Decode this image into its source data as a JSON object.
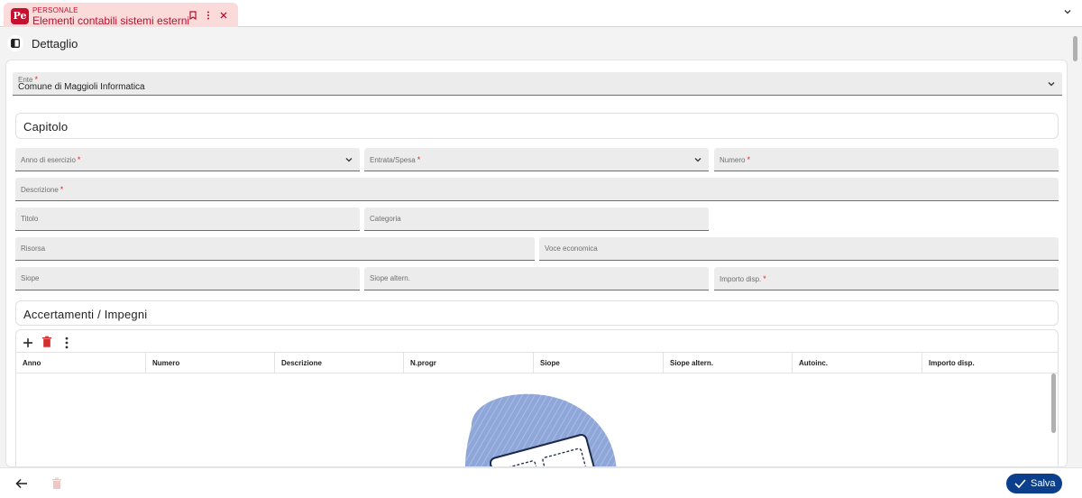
{
  "app": {
    "section": "PERSONALE",
    "title": "Elementi contabili sistemi esterni",
    "logo_text": "Pe"
  },
  "header": {
    "title": "Dettaglio"
  },
  "ente": {
    "label": "Ente",
    "value": "Comune di Maggioli Informatica"
  },
  "capitolo": {
    "title": "Capitolo",
    "fields": {
      "anno": "Anno di esercizio",
      "entrata_spesa": "Entrata/Spesa",
      "numero": "Numero",
      "descrizione": "Descrizione",
      "titolo": "Titolo",
      "categoria": "Categoria",
      "risorsa": "Risorsa",
      "voce_economica": "Voce economica",
      "siope": "Siope",
      "siope_altern": "Siope altern.",
      "importo_disp": "Importo disp."
    }
  },
  "accertamenti": {
    "title": "Accertamenti / Impegni",
    "columns": [
      "Anno",
      "Numero",
      "Descrizione",
      "N.progr",
      "Siope",
      "Siope altern.",
      "Autoinc.",
      "Importo disp."
    ]
  },
  "footer": {
    "save_label": "Salva"
  },
  "colors": {
    "brand": "#c8102e",
    "primary": "#0b3f8c",
    "tab_bg": "#fbdada"
  },
  "icons": [
    "pe-logo-icon",
    "bookmark-icon",
    "more-vert-icon",
    "close-icon",
    "chevron-down-icon",
    "side-panel-icon",
    "add-icon",
    "delete-icon",
    "arrow-back-icon",
    "check-icon",
    "empty-state-illustration"
  ]
}
